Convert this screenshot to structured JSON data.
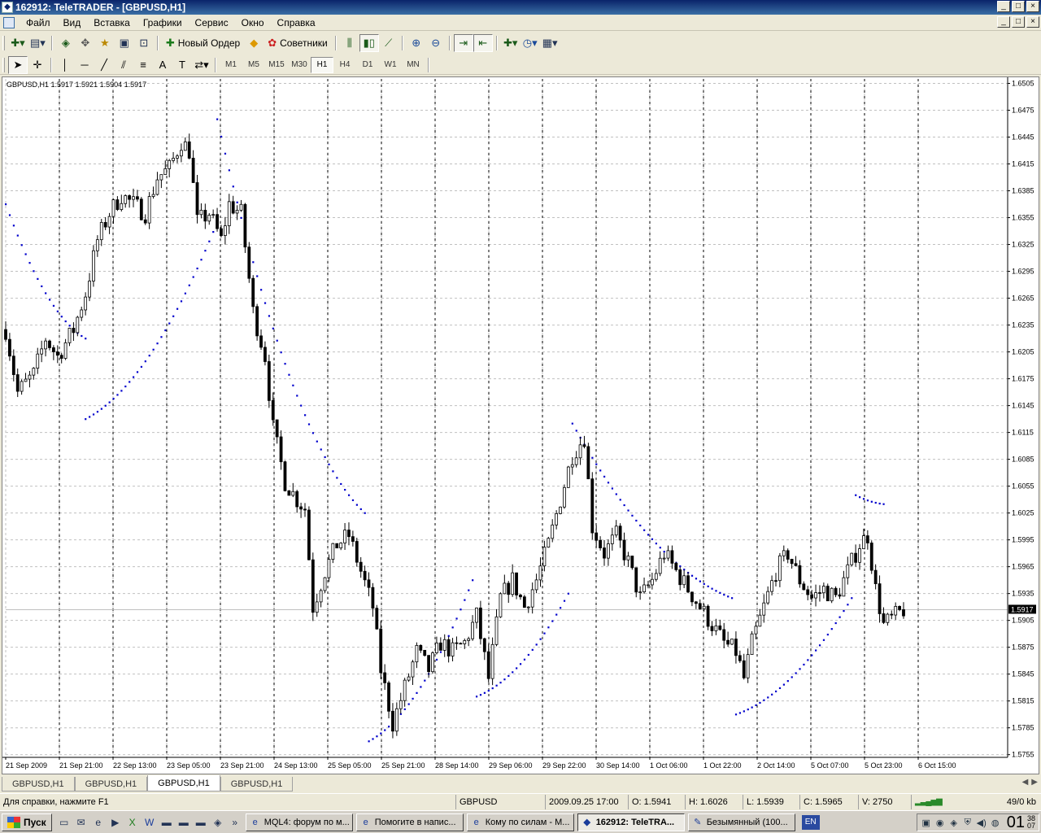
{
  "window": {
    "title": "162912: TeleTRADER - [GBPUSD,H1]",
    "controls": [
      "_",
      "□",
      "×"
    ]
  },
  "menu": [
    "Файл",
    "Вид",
    "Вставка",
    "Графики",
    "Сервис",
    "Окно",
    "Справка"
  ],
  "toolbar1": {
    "new_order_label": "Новый Ордер",
    "advisors_label": "Советники"
  },
  "timeframes": [
    "M1",
    "M5",
    "M15",
    "M30",
    "H1",
    "H4",
    "D1",
    "W1",
    "MN"
  ],
  "active_timeframe": "H1",
  "chart": {
    "header": "GBPUSD,H1  1.5917 1.5921 1.5904 1.5917",
    "current_price_label": "1.5917"
  },
  "chart_data": {
    "type": "candlestick",
    "symbol": "GBPUSD",
    "timeframe": "H1",
    "title": "GBPUSD,H1  1.5917 1.5921 1.5904 1.5917",
    "current_price": 1.5917,
    "y_axis": {
      "ticks": [
        1.6505,
        1.6475,
        1.6445,
        1.6415,
        1.6385,
        1.6355,
        1.6325,
        1.6295,
        1.6265,
        1.6235,
        1.6205,
        1.6175,
        1.6145,
        1.6115,
        1.6085,
        1.6055,
        1.6025,
        1.5995,
        1.5965,
        1.5935,
        1.5905,
        1.5875,
        1.5845,
        1.5815,
        1.5785,
        1.5755
      ],
      "range": [
        1.5752,
        1.651
      ]
    },
    "x_axis": {
      "ticks": [
        "21 Sep 2009",
        "21 Sep 21:00",
        "22 Sep 13:00",
        "23 Sep 05:00",
        "23 Sep 21:00",
        "24 Sep 13:00",
        "25 Sep 05:00",
        "25 Sep 21:00",
        "28 Sep 14:00",
        "29 Sep 06:00",
        "29 Sep 22:00",
        "30 Sep 14:00",
        "1 Oct 06:00",
        "1 Oct 22:00",
        "2 Oct 14:00",
        "5 Oct 07:00",
        "5 Oct 23:00",
        "6 Oct 15:00"
      ]
    },
    "grid": true,
    "close_path": [
      [
        0,
        1.623
      ],
      [
        3,
        1.616
      ],
      [
        7,
        1.618
      ],
      [
        10,
        1.622
      ],
      [
        13,
        1.62
      ],
      [
        17,
        1.623
      ],
      [
        20,
        1.627
      ],
      [
        23,
        1.633
      ],
      [
        26,
        1.636
      ],
      [
        29,
        1.638
      ],
      [
        32,
        1.637
      ],
      [
        35,
        1.636
      ],
      [
        38,
        1.64
      ],
      [
        41,
        1.641
      ],
      [
        44,
        1.644
      ],
      [
        46,
        1.643
      ],
      [
        48,
        1.635
      ],
      [
        51,
        1.636
      ],
      [
        54,
        1.633
      ],
      [
        56,
        1.637
      ],
      [
        59,
        1.636
      ],
      [
        62,
        1.625
      ],
      [
        65,
        1.62
      ],
      [
        67,
        1.612
      ],
      [
        70,
        1.606
      ],
      [
        73,
        1.604
      ],
      [
        75,
        1.603
      ],
      [
        77,
        1.592
      ],
      [
        80,
        1.596
      ],
      [
        83,
        1.599
      ],
      [
        86,
        1.6
      ],
      [
        89,
        1.596
      ],
      [
        92,
        1.592
      ],
      [
        94,
        1.585
      ],
      [
        97,
        1.579
      ],
      [
        100,
        1.583
      ],
      [
        103,
        1.587
      ],
      [
        106,
        1.585
      ],
      [
        109,
        1.588
      ],
      [
        112,
        1.587
      ],
      [
        115,
        1.588
      ],
      [
        118,
        1.591
      ],
      [
        121,
        1.584
      ],
      [
        124,
        1.593
      ],
      [
        127,
        1.595
      ],
      [
        130,
        1.592
      ],
      [
        133,
        1.595
      ],
      [
        136,
        1.599
      ],
      [
        139,
        1.604
      ],
      [
        142,
        1.609
      ],
      [
        145,
        1.611
      ],
      [
        147,
        1.601
      ],
      [
        150,
        1.598
      ],
      [
        153,
        1.6
      ],
      [
        156,
        1.597
      ],
      [
        159,
        1.593
      ],
      [
        162,
        1.595
      ],
      [
        165,
        1.598
      ],
      [
        168,
        1.596
      ],
      [
        171,
        1.594
      ],
      [
        174,
        1.592
      ],
      [
        177,
        1.59
      ],
      [
        180,
        1.588
      ],
      [
        183,
        1.587
      ],
      [
        185,
        1.584
      ],
      [
        187,
        1.588
      ],
      [
        190,
        1.592
      ],
      [
        193,
        1.596
      ],
      [
        196,
        1.598
      ],
      [
        199,
        1.595
      ],
      [
        202,
        1.593
      ],
      [
        205,
        1.594
      ],
      [
        208,
        1.593
      ],
      [
        211,
        1.596
      ],
      [
        214,
        1.599
      ],
      [
        216,
        1.6
      ],
      [
        218,
        1.594
      ],
      [
        220,
        1.59
      ],
      [
        223,
        1.591
      ],
      [
        225,
        1.5917
      ]
    ],
    "parabolic_sar": [
      {
        "x": [
          0,
          20
        ],
        "y": [
          1.637,
          1.622
        ]
      },
      {
        "x": [
          20,
          53
        ],
        "y": [
          1.613,
          1.635
        ]
      },
      {
        "x": [
          53,
          90
        ],
        "y": [
          1.6465,
          1.6025
        ]
      },
      {
        "x": [
          91,
          117
        ],
        "y": [
          1.577,
          1.595
        ]
      },
      {
        "x": [
          118,
          141
        ],
        "y": [
          1.582,
          1.5935
        ]
      },
      {
        "x": [
          142,
          182
        ],
        "y": [
          1.6125,
          1.593
        ]
      },
      {
        "x": [
          183,
          212
        ],
        "y": [
          1.58,
          1.593
        ]
      },
      {
        "x": [
          213,
          220
        ],
        "y": [
          1.6045,
          1.6035
        ]
      }
    ],
    "colors": {
      "candles": "#000000",
      "sar": "#0000cc",
      "grid": "#c0c0c0",
      "background": "#ffffff"
    }
  },
  "chart_tabs": [
    "GBPUSD,H1",
    "GBPUSD,H1",
    "GBPUSD,H1",
    "GBPUSD,H1"
  ],
  "active_tab": 2,
  "status": {
    "help": "Для справки, нажмите F1",
    "symbol": "GBPUSD",
    "datetime": "2009.09.25 17:00",
    "open": "O: 1.5941",
    "high": "H: 1.6026",
    "low": "L: 1.5939",
    "close": "C: 1.5965",
    "volume": "V: 2750",
    "traffic": "49/0 kb"
  },
  "taskbar": {
    "start_label": "Пуск",
    "tasks": [
      {
        "label": "MQL4: форум по м...",
        "icon": "ie-icon"
      },
      {
        "label": "Помогите в напис...",
        "icon": "ie-icon"
      },
      {
        "label": "Кому по силам - М...",
        "icon": "ie-icon"
      },
      {
        "label": "162912: TeleTRA...",
        "icon": "teletrader-icon",
        "active": true
      },
      {
        "label": "Безымянный (100...",
        "icon": "paint-icon"
      }
    ],
    "language": "EN",
    "clock_hour": "01",
    "clock_min": "38",
    "clock_sec": "07"
  }
}
